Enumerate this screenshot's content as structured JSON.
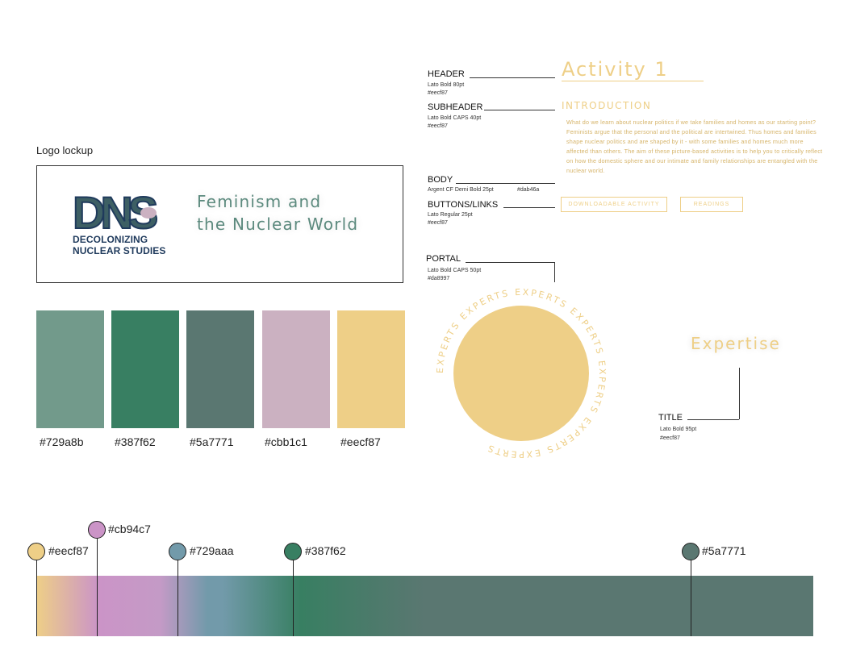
{
  "logo": {
    "label": "Logo lockup",
    "mark": "DNS",
    "subtitle_line1": "DECOLONIZING",
    "subtitle_line2": "NUCLEAR STUDIES",
    "title_line1": "Feminism and",
    "title_line2": "the Nuclear World"
  },
  "swatches": [
    {
      "hex": "#729a8b",
      "label": "#729a8b"
    },
    {
      "hex": "#387f62",
      "label": "#387f62"
    },
    {
      "hex": "#5a7771",
      "label": "#5a7771"
    },
    {
      "hex": "#cbb1c1",
      "label": "#cbb1c1"
    },
    {
      "hex": "#eecf87",
      "label": "#eecf87"
    }
  ],
  "specs": {
    "header": {
      "title": "HEADER",
      "font": "Lato Bold 80pt",
      "color": "#eecf87"
    },
    "subheader": {
      "title": "SUBHEADER",
      "font": "Lato Bold CAPS 40pt",
      "color": "#eecf87"
    },
    "body": {
      "title": "BODY",
      "font": "Argent CF Demi Bold 25pt",
      "color": "#dab46a"
    },
    "buttons": {
      "title": "BUTTONS/LINKS",
      "font": "Lato Regular 25pt",
      "color": "#eecf87"
    },
    "portal": {
      "title": "PORTAL",
      "font": "Lato Bold CAPS 50pt",
      "color": "#da8997"
    },
    "title": {
      "title": "TITLE",
      "font": "Lato Bold 95pt",
      "color": "#eecf87"
    }
  },
  "sample": {
    "activity_title": "Activity 1",
    "intro_head": "INTRODUCTION",
    "intro_body": "What do we learn about nuclear politics if we take families and homes as our starting point? Feminists argue that the personal and the political are intertwined. Thus homes and families shape nuclear politics and are shaped by it - with some families and homes much more affected than others. The aim of these picture-based activities is to help you to critically reflect on how the domestic sphere and our intimate and family relationships are entangled with the nuclear world.",
    "button1": "DOWNLOADABLE ACTIVITY",
    "button2": "READINGS",
    "portal_text": "EXPERTS",
    "expertise": "Expertise"
  },
  "gradient_pins": [
    {
      "hex": "#eecf87",
      "label": "#eecf87"
    },
    {
      "hex": "#cb94c7",
      "label": "#cb94c7"
    },
    {
      "hex": "#729aaa",
      "label": "#729aaa"
    },
    {
      "hex": "#387f62",
      "label": "#387f62"
    },
    {
      "hex": "#5a7771",
      "label": "#5a7771"
    }
  ]
}
